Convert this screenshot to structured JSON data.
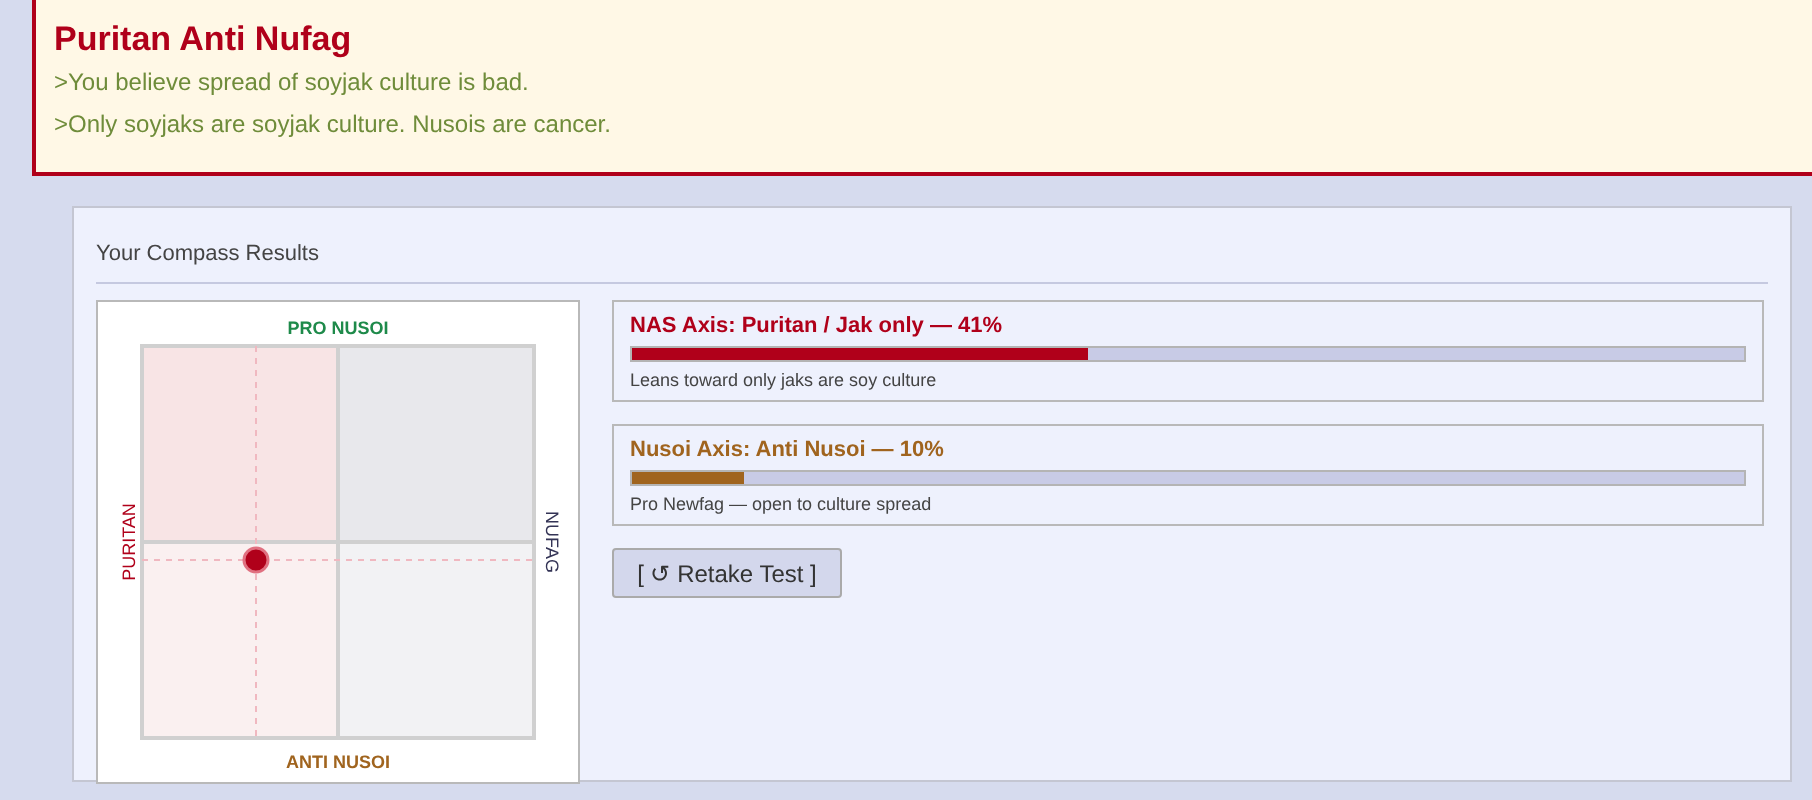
{
  "banner": {
    "title": "Puritan Anti Nufag",
    "lines": [
      ">You believe spread of soyjak culture is bad.",
      ">Only soyjaks are soyjak culture. Nusois are cancer."
    ]
  },
  "results": {
    "heading": "Your Compass Results",
    "compass": {
      "top": "PRO NUSOI",
      "bottom": "ANTI NUSOI",
      "left": "PURITAN",
      "right": "NUFAG"
    },
    "axes": [
      {
        "kind": "nas",
        "title": "NAS Axis: Puritan / Jak only — 41%",
        "level": 0.41,
        "note": "Leans toward only jaks are soy culture"
      },
      {
        "kind": "nusoi",
        "title": "Nusoi Axis: Anti Nusoi — 10%",
        "level": 0.1,
        "note": "Pro Newfag — open to culture spread"
      }
    ],
    "retake_button": "[ ↺ Retake Test ]"
  }
}
